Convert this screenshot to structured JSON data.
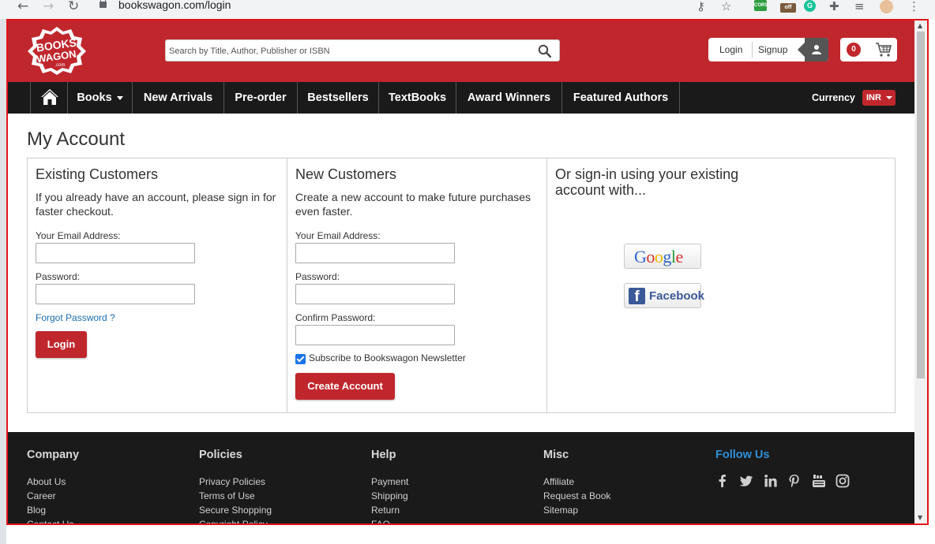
{
  "browser": {
    "url": "bookswagon.com/login",
    "extensions": {
      "cors_label": "CORS",
      "off_label": "off"
    }
  },
  "header": {
    "logo_text": [
      "BOOKS",
      "WAGON",
      ".com"
    ],
    "search_placeholder": "Search by Title, Author, Publisher or ISBN",
    "login_label": "Login",
    "signup_label": "Signup",
    "cart_count": "0"
  },
  "nav": {
    "items": [
      {
        "label": "Books"
      },
      {
        "label": "New Arrivals"
      },
      {
        "label": "Pre-order"
      },
      {
        "label": "Bestsellers"
      },
      {
        "label": "TextBooks"
      },
      {
        "label": "Award Winners"
      },
      {
        "label": "Featured Authors"
      }
    ],
    "currency_label": "Currency",
    "currency_value": "INR"
  },
  "account": {
    "title": "My Account",
    "existing": {
      "heading": "Existing Customers",
      "description": "If you already have an account, please sign in for faster checkout.",
      "email_label": "Your Email Address:",
      "password_label": "Password:",
      "forgot_label": "Forgot Password ?",
      "login_button": "Login"
    },
    "new": {
      "heading": "New Customers",
      "description": "Create a new account to make future purchases even faster.",
      "email_label": "Your Email Address:",
      "password_label": "Password:",
      "confirm_label": "Confirm Password:",
      "newsletter_label": "Subscribe to Bookswagon Newsletter",
      "newsletter_checked": true,
      "create_button": "Create Account"
    },
    "social": {
      "heading": "Or sign-in using your existing account with...",
      "google_label": "Google",
      "facebook_label": "Facebook"
    }
  },
  "footer": {
    "columns": [
      {
        "title": "Company",
        "links": [
          "About Us",
          "Career",
          "Blog",
          "Contact Us"
        ]
      },
      {
        "title": "Policies",
        "links": [
          "Privacy Policies",
          "Terms of Use",
          "Secure Shopping",
          "Copyright Policy"
        ]
      },
      {
        "title": "Help",
        "links": [
          "Payment",
          "Shipping",
          "Return",
          "FAQ"
        ]
      },
      {
        "title": "Misc",
        "links": [
          "Affiliate",
          "Request a Book",
          "Sitemap"
        ]
      }
    ],
    "follow_title": "Follow Us",
    "social_icons": [
      "facebook-icon",
      "twitter-icon",
      "linkedin-icon",
      "pinterest-icon",
      "youtube-icon",
      "instagram-icon"
    ]
  },
  "colors": {
    "brand_red": "#c0272d",
    "nav_dark": "#1a1a1a",
    "link_blue": "#1a6fb3",
    "follow_blue": "#2f8fd8"
  }
}
